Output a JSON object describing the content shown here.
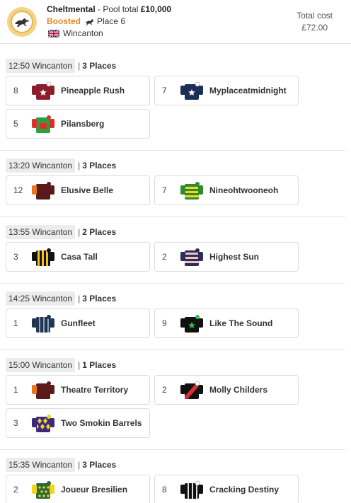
{
  "header": {
    "brand": "Cheltmental",
    "pool_label": " - Pool total ",
    "pool_amount": "£10,000",
    "boosted": "Boosted",
    "place": "Place 6",
    "venue": "Wincanton",
    "total_cost_label": "Total cost",
    "total_cost": "£72.00"
  },
  "colors": {
    "boosted": "#e8891a",
    "border": "#dcdcdc",
    "time_bg": "#ececec"
  },
  "races": [
    {
      "time": "12:50 Wincanton",
      "places": "3 Places",
      "runners": [
        {
          "number": "8",
          "name": "Pineapple Rush",
          "silk": "maroon-star"
        },
        {
          "number": "7",
          "name": "Myplaceatmidnight",
          "silk": "navy-star"
        },
        {
          "number": "5",
          "name": "Pilansberg",
          "silk": "red-green"
        }
      ]
    },
    {
      "time": "13:20 Wincanton",
      "places": "3 Places",
      "runners": [
        {
          "number": "12",
          "name": "Elusive Belle",
          "silk": "maroon-orange"
        },
        {
          "number": "7",
          "name": "Nineohtwooneoh",
          "silk": "green-yellow-hoops"
        }
      ]
    },
    {
      "time": "13:55 Wincanton",
      "places": "2 Places",
      "runners": [
        {
          "number": "3",
          "name": "Casa Tall",
          "silk": "black-yellow-stripes"
        },
        {
          "number": "2",
          "name": "Highest Sun",
          "silk": "navy-pink-hoops"
        }
      ]
    },
    {
      "time": "14:25 Wincanton",
      "places": "3 Places",
      "runners": [
        {
          "number": "1",
          "name": "Gunfleet",
          "silk": "navy-stripes"
        },
        {
          "number": "9",
          "name": "Like The Sound",
          "silk": "black-green-star"
        }
      ]
    },
    {
      "time": "15:00 Wincanton",
      "places": "1 Places",
      "runners": [
        {
          "number": "1",
          "name": "Theatre Territory",
          "silk": "maroon-orange"
        },
        {
          "number": "2",
          "name": "Molly Childers",
          "silk": "black-red-sash"
        },
        {
          "number": "3",
          "name": "Two Smokin Barrels",
          "silk": "purple-yellow-diamonds"
        }
      ]
    },
    {
      "time": "15:35 Wincanton",
      "places": "3 Places",
      "runners": [
        {
          "number": "2",
          "name": "Joueur Bresilien",
          "silk": "green-yellow-spots"
        },
        {
          "number": "8",
          "name": "Cracking Destiny",
          "silk": "black-white-stripes"
        }
      ]
    }
  ]
}
